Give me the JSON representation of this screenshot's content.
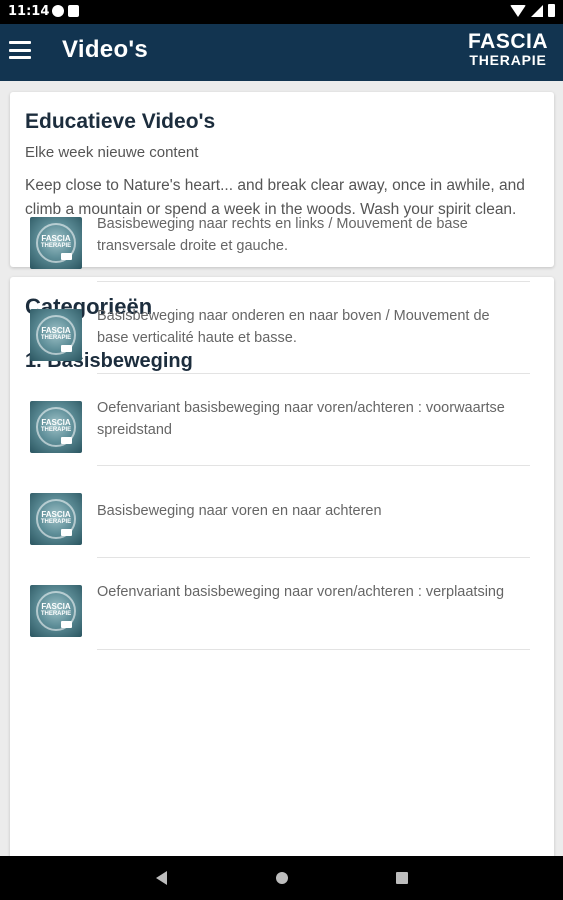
{
  "status_bar": {
    "time": "11:14"
  },
  "app_bar": {
    "title": "Video's",
    "brand": {
      "line1": "FASCIA",
      "line2": "THERAPIE"
    }
  },
  "intro": {
    "title": "Educatieve Video's",
    "subtitle": "Elke week nieuwe content",
    "description": "Keep close to Nature's heart... and break clear away, once in awhile, and climb a mountain or spend a week in the woods. Wash your spirit clean."
  },
  "categories": {
    "heading": "Categorieën",
    "section_title": "1. Basisbeweging",
    "videos": [
      {
        "title": "Basisbeweging naar rechts en links / Mouvement de base transversale droite et gauche."
      },
      {
        "title": "Basisbeweging naar onderen en naar boven / Mouvement de base verticalité haute et basse."
      },
      {
        "title": "Oefenvariant basisbeweging naar voren/achteren : voorwaartse spreidstand"
      },
      {
        "title": "Basisbeweging naar voren en naar achteren"
      },
      {
        "title": "Oefenvariant basisbeweging naar voren/achteren : verplaatsing"
      }
    ]
  },
  "thumbnail": {
    "line1": "FASCIA",
    "line2": "THERAPIE"
  },
  "colors": {
    "app_bar": "#123450",
    "heading": "#1c2d3d",
    "body_text": "#555555"
  }
}
